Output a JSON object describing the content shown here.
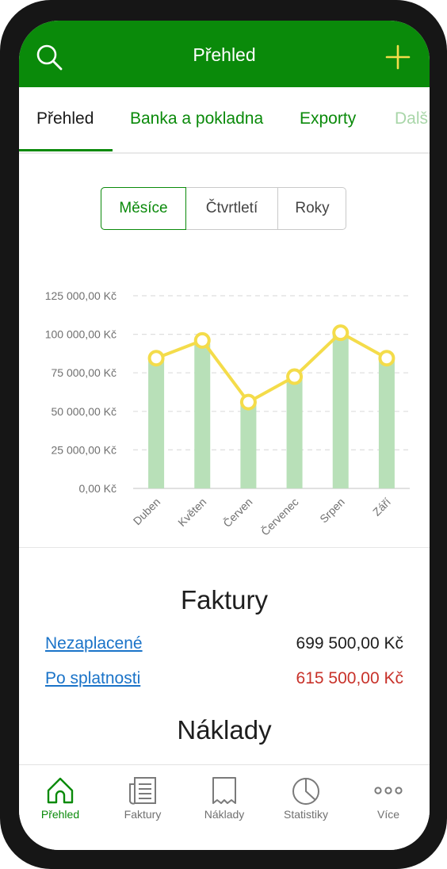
{
  "header": {
    "title": "Přehled"
  },
  "tabs": [
    {
      "label": "Přehled"
    },
    {
      "label": "Banka a pokladna"
    },
    {
      "label": "Exporty"
    },
    {
      "label": "Další"
    }
  ],
  "period_selector": {
    "options": [
      "Měsíce",
      "Čtvrtletí",
      "Roky"
    ],
    "selected": "Měsíce"
  },
  "chart_data": {
    "type": "bar",
    "categories": [
      "Duben",
      "Květen",
      "Červen",
      "Červenec",
      "Srpen",
      "Září"
    ],
    "series": [
      {
        "type": "bar",
        "values": [
          83500,
          94000,
          55000,
          71500,
          99500,
          83500
        ],
        "color": "#b8e0b8"
      },
      {
        "type": "line",
        "values": [
          84500,
          96000,
          56000,
          72500,
          101000,
          84500
        ],
        "color": "#f4dc4a"
      }
    ],
    "ylim": [
      0,
      125000
    ],
    "yticks": [
      0,
      25000,
      50000,
      75000,
      100000,
      125000
    ],
    "ytick_labels": [
      "0,00 Kč",
      "25 000,00 Kč",
      "50 000,00 Kč",
      "75 000,00 Kč",
      "100 000,00 Kč",
      "125 000,00 Kč"
    ],
    "grid": true
  },
  "faktury": {
    "title": "Faktury",
    "rows": [
      {
        "label": "Nezaplacené",
        "value": "699 500,00 Kč"
      },
      {
        "label": "Po splatnosti",
        "value": "615 500,00 Kč"
      }
    ]
  },
  "naklady": {
    "title": "Náklady"
  },
  "bottom_nav": [
    {
      "label": "Přehled",
      "icon": "home-icon"
    },
    {
      "label": "Faktury",
      "icon": "invoice-icon"
    },
    {
      "label": "Náklady",
      "icon": "receipt-icon"
    },
    {
      "label": "Statistiky",
      "icon": "pie-chart-icon"
    },
    {
      "label": "Více",
      "icon": "more-dots-icon"
    }
  ],
  "colors": {
    "brand_green": "#0a8a0a",
    "accent_yellow": "#f4dc4a",
    "link_blue": "#1a73c8",
    "overdue_red": "#c8322a"
  }
}
